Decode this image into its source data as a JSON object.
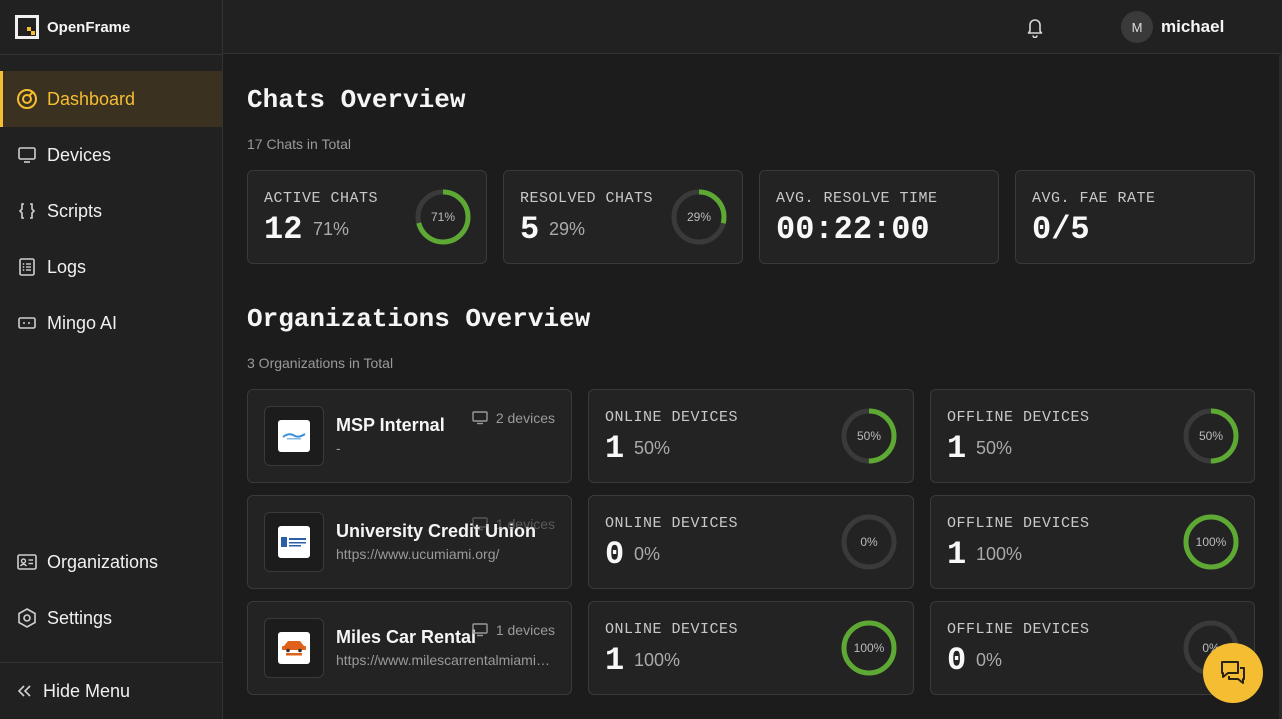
{
  "app": {
    "brand": "OpenFrame",
    "accent": "#f5bd31",
    "ring_green": "#5ea934",
    "ring_track": "#3a3a3a"
  },
  "sidebar": {
    "items": [
      {
        "label": "Dashboard",
        "icon": "dashboard-icon",
        "active": true
      },
      {
        "label": "Devices",
        "icon": "monitor-icon"
      },
      {
        "label": "Scripts",
        "icon": "braces-icon"
      },
      {
        "label": "Logs",
        "icon": "list-icon"
      },
      {
        "label": "Mingo AI",
        "icon": "ai-chat-icon"
      }
    ],
    "bottom_items": [
      {
        "label": "Organizations",
        "icon": "id-card-icon"
      },
      {
        "label": "Settings",
        "icon": "gear-icon"
      }
    ],
    "hide_menu_label": "Hide Menu"
  },
  "topbar": {
    "bell_icon": "bell-icon",
    "user": {
      "initial": "M",
      "name": "michael"
    }
  },
  "chats": {
    "title": "Chats Overview",
    "subtitle": "17 Chats in Total",
    "cards": [
      {
        "label": "ACTIVE CHATS",
        "value": "12",
        "pct": "71%",
        "ring": 71
      },
      {
        "label": "RESOLVED CHATS",
        "value": "5",
        "pct": "29%",
        "ring": 29
      },
      {
        "label": "AVG. RESOLVE TIME",
        "value": "00:22:00"
      },
      {
        "label": "AVG. FAE RATE",
        "value": "0/5"
      }
    ]
  },
  "orgs": {
    "title": "Organizations Overview",
    "subtitle": "3 Organizations in Total",
    "rows": [
      {
        "name": "MSP Internal",
        "site": "-",
        "devices": "2 devices",
        "online": {
          "label": "ONLINE DEVICES",
          "value": "1",
          "pct": "50%",
          "ring": 50
        },
        "offline": {
          "label": "OFFLINE DEVICES",
          "value": "1",
          "pct": "50%",
          "ring": 50
        }
      },
      {
        "name": "University Credit Union",
        "site": "https://www.ucumiami.org/",
        "devices": "1 devices",
        "online": {
          "label": "ONLINE DEVICES",
          "value": "0",
          "pct": "0%",
          "ring": 0
        },
        "offline": {
          "label": "OFFLINE DEVICES",
          "value": "1",
          "pct": "100%",
          "ring": 100
        }
      },
      {
        "name": "Miles Car Rental",
        "site": "https://www.milescarrentalmiami.com/",
        "devices": "1 devices",
        "online": {
          "label": "ONLINE DEVICES",
          "value": "1",
          "pct": "100%",
          "ring": 100
        },
        "offline": {
          "label": "OFFLINE DEVICES",
          "value": "0",
          "pct": "0%",
          "ring": 0
        }
      }
    ]
  },
  "fab_icon": "chat-bubbles-icon"
}
